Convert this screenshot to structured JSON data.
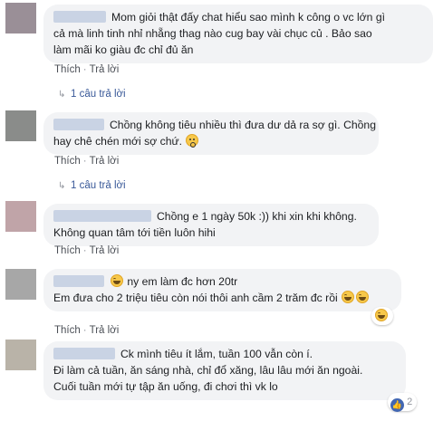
{
  "comments": [
    {
      "avatar_color": "#9a8f97",
      "lines": [
        "Mom giỏi thật đấy chat hiểu sao mình k công o vc lớn gì",
        "cả mà linh tinh nhỉ nhẵng thag nào cug bay vài chục củ . Bảo sao",
        "làm mãi ko giàu đc chỉ đủ ăn"
      ],
      "actions": {
        "like": "Thích",
        "separator": "·",
        "reply": "Trả lời"
      },
      "replies_label": "1 câu trả lời"
    },
    {
      "avatar_color": "#8a8c8a",
      "lines": [
        "Chồng không tiêu nhiều thì đưa dư dả ra sợ gì. Chồng",
        "hay chê chén mới sợ chứ."
      ],
      "emoji": "fearful-face-emoji",
      "actions": {
        "like": "Thích",
        "separator": "·",
        "reply": "Trả lời"
      },
      "replies_label": "1 câu trả lời"
    },
    {
      "avatar_color": "#c0a4a8",
      "lines": [
        "Chồng e 1 ngày 50k :)) khi xin khi không.",
        "Không quan tâm tới tiền luôn hihi"
      ],
      "actions": {
        "like": "Thích",
        "separator": "·",
        "reply": "Trả lời"
      }
    },
    {
      "avatar_color": "#a7a7a7",
      "lines": [
        "ny em làm đc hơn 20tr",
        "Em đưa cho 2 triệu tiêu còn nói thôi anh cầm 2 trăm đc rồi"
      ],
      "reaction": {
        "icon": "laughing-reaction-icon",
        "count": ""
      },
      "actions": {
        "like": "Thích",
        "separator": "·",
        "reply": "Trả lời"
      }
    },
    {
      "avatar_color": "#b9b3a8",
      "lines": [
        "Ck mình tiêu ít lắm, tuần 100 vẫn còn í.",
        "Đi làm cả tuần, ăn sáng nhà, chỉ đổ xăng, lâu lâu mới ăn ngoài.",
        "Cuối tuần mới tự tập ăn uống, đi chơi thì vk lo"
      ],
      "reaction": {
        "icon": "like-reaction-icon",
        "count": "2"
      },
      "actions": {
        "like": "Thích",
        "separator": "·",
        "reply": "Trả lời"
      }
    }
  ]
}
